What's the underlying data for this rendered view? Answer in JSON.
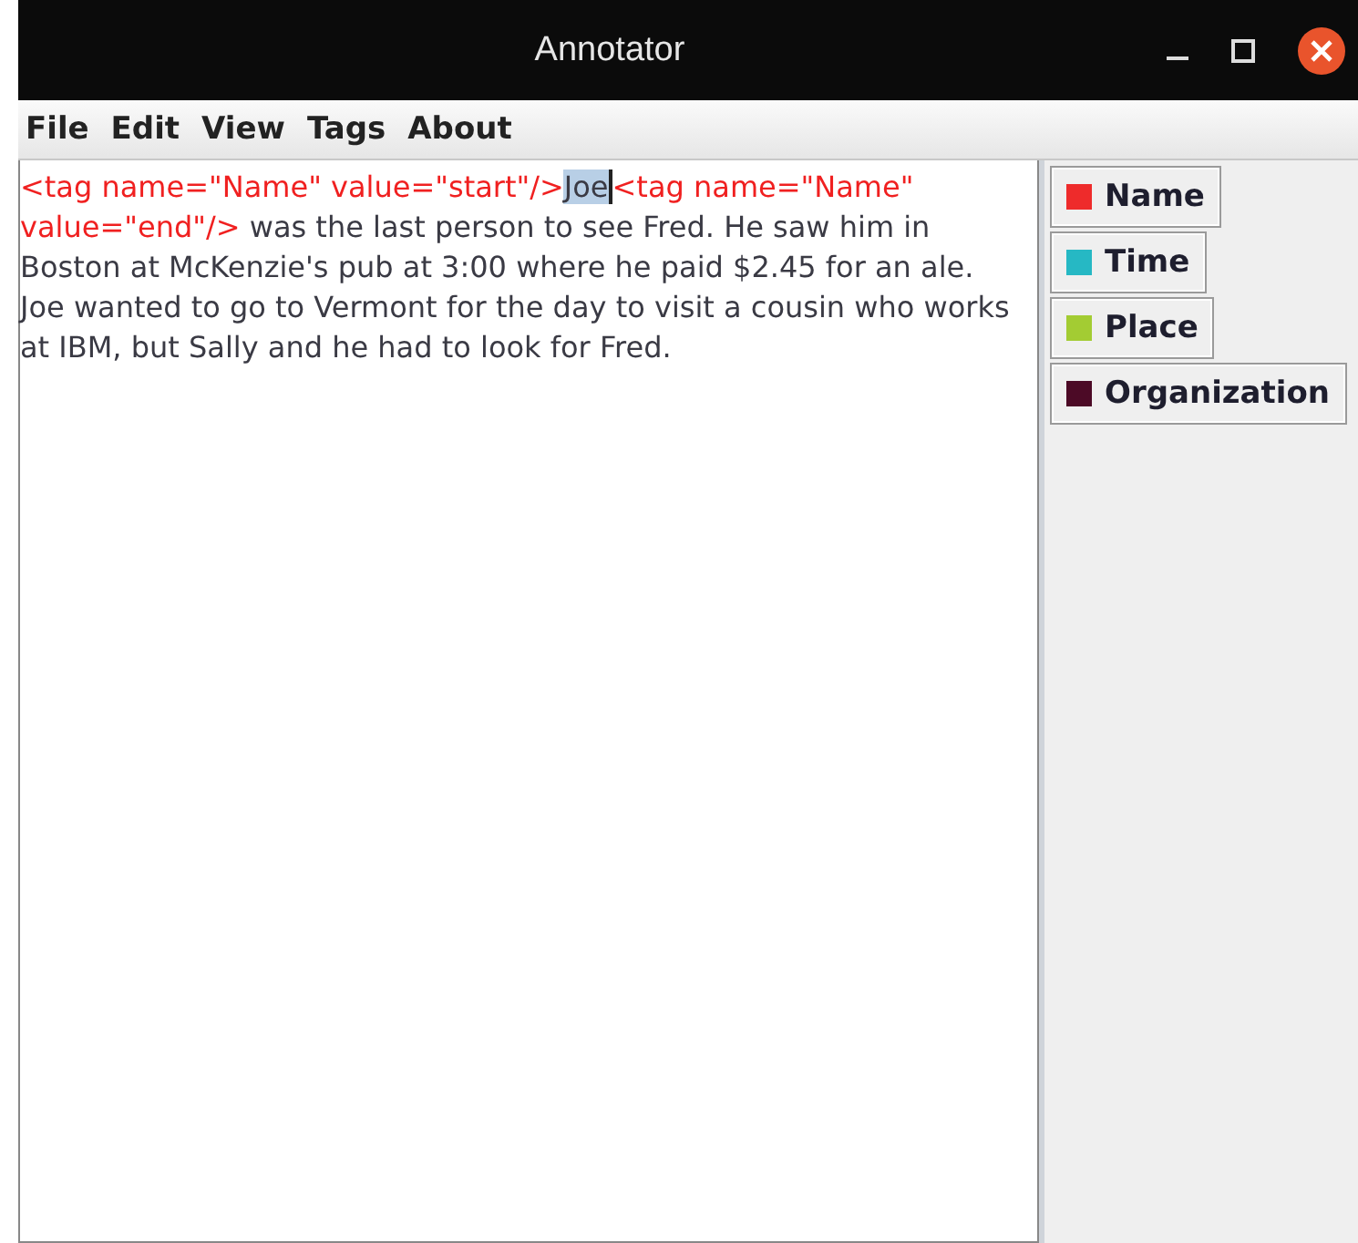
{
  "window": {
    "title": "Annotator"
  },
  "menu": [
    "File",
    "Edit",
    "View",
    "Tags",
    "About"
  ],
  "document": [
    {
      "kind": "tag",
      "text": "<tag name=\"Name\" value=\"start\"/>"
    },
    {
      "kind": "selection",
      "text": "Joe"
    },
    {
      "kind": "tag",
      "text": "<tag name=\"Name\" value=\"end\"/>"
    },
    {
      "kind": "text",
      "text": " was the last person to see Fred. He saw him in Boston at McKenzie's pub at 3:00 where he paid $2.45 for an ale. Joe wanted to go to Vermont for the day to visit a cousin who works at IBM, but Sally and he had to look for Fred."
    }
  ],
  "tags": [
    {
      "label": "Name",
      "color": "#ee2b2b"
    },
    {
      "label": "Time",
      "color": "#26b8c4"
    },
    {
      "label": "Place",
      "color": "#a3cc33"
    },
    {
      "label": "Organization",
      "color": "#4c0a26"
    }
  ]
}
